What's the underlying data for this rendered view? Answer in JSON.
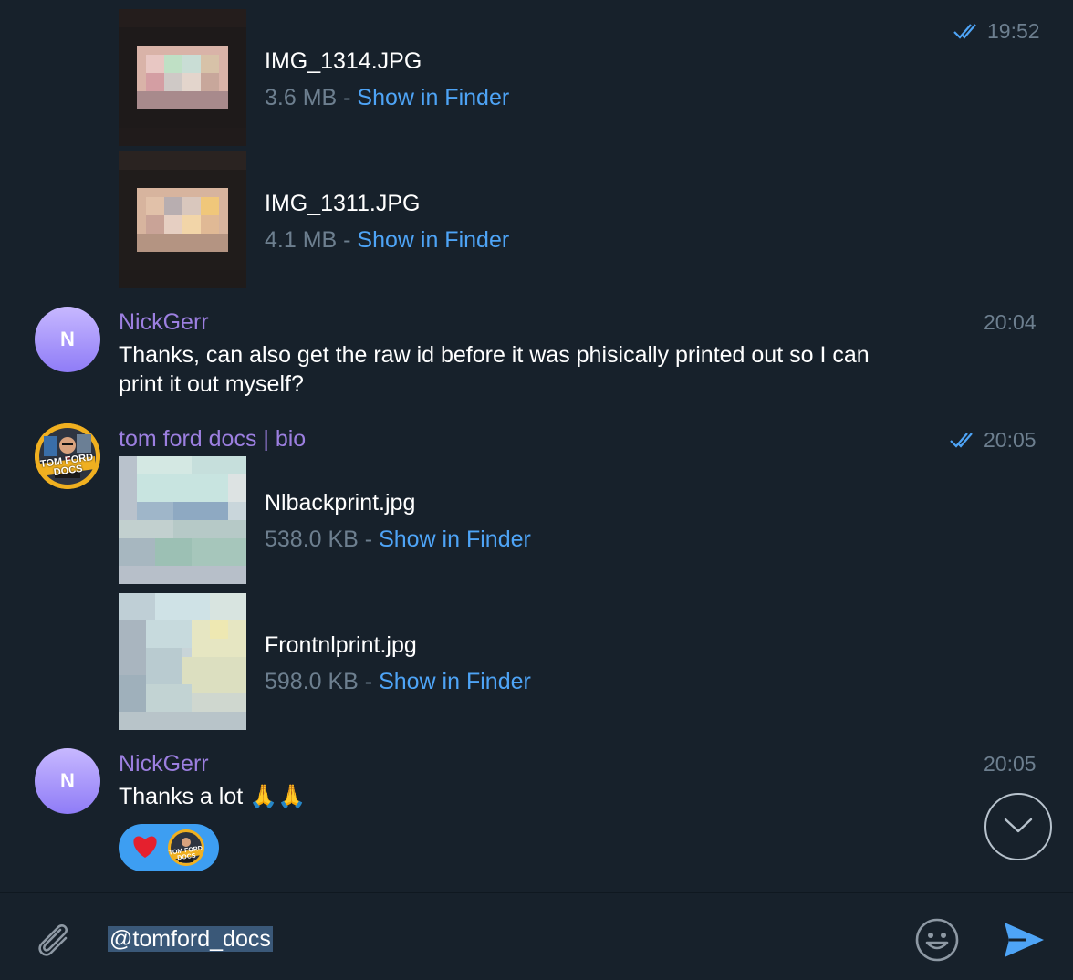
{
  "messages": [
    {
      "files": [
        {
          "name": "IMG_1314.JPG",
          "size": "3.6 MB",
          "separator": " - ",
          "action": "Show in Finder"
        },
        {
          "name": "IMG_1311.JPG",
          "size": "4.1 MB",
          "separator": " - ",
          "action": "Show in Finder"
        }
      ],
      "time": "19:52",
      "read": true
    },
    {
      "sender": "NickGerr",
      "avatar_letter": "N",
      "text_line1": "Thanks, can also get the raw id before it was phisically printed out so I can",
      "text_line2": "print it out myself?",
      "time": "20:04"
    },
    {
      "sender": "tom ford docs | bio",
      "avatar_text": "TOM FORD DOCS",
      "files": [
        {
          "name": "Nlbackprint.jpg",
          "size": "538.0 KB",
          "separator": " - ",
          "action": "Show in Finder"
        },
        {
          "name": "Frontnlprint.jpg",
          "size": "598.0 KB",
          "separator": " - ",
          "action": "Show in Finder"
        }
      ],
      "time": "20:05",
      "read": true
    },
    {
      "sender": "NickGerr",
      "avatar_letter": "N",
      "text": "Thanks a lot 🙏🙏",
      "time": "20:05",
      "reaction": {
        "emoji": "❤️",
        "by_avatar_text": "TOM FORD DOCS"
      }
    }
  ],
  "composer": {
    "value": "@tomford_docs",
    "attach_icon": "paperclip-icon",
    "emoji_icon": "smiley-icon",
    "send_icon": "send-icon"
  },
  "colors": {
    "background": "#17212b",
    "accent": "#4ea4f6",
    "sender": "#9c7fe0",
    "muted": "#6d7f8f"
  }
}
